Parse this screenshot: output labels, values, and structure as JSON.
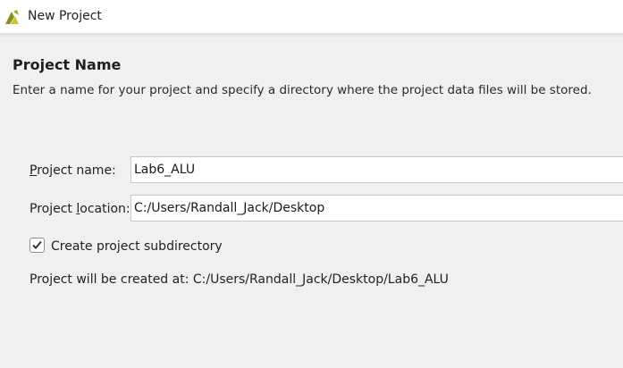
{
  "window": {
    "title": "New Project",
    "app_icon": "vivado-logo-icon"
  },
  "page": {
    "heading": "Project Name",
    "description": "Enter a name for your project and specify a directory where the project data files will be stored."
  },
  "form": {
    "project_name": {
      "label_mnemonic": "P",
      "label_rest": "roject name:",
      "value": "Lab6_ALU"
    },
    "project_location": {
      "label_before": "Project ",
      "label_mnemonic": "l",
      "label_after": "ocation:",
      "value": "C:/Users/Randall_Jack/Desktop"
    },
    "create_subdirectory": {
      "label": "Create project subdirectory",
      "checked": true
    },
    "created_at_text": "Project will be created at: C:/Users/Randall_Jack/Desktop/Lab6_ALU"
  },
  "colors": {
    "background": "#f0f0f0",
    "titlebar": "#ffffff",
    "logo_dark": "#7a7a1a",
    "logo_light": "#c8c830"
  }
}
